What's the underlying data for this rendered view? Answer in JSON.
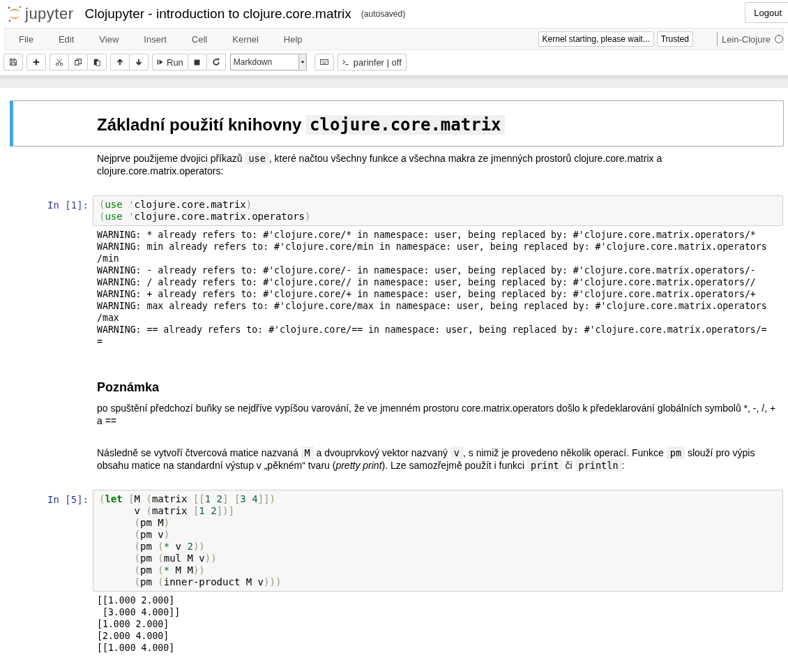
{
  "header": {
    "logo_text": "jupyter",
    "title": "Clojupyter - introduction to clojure.core.matrix",
    "save_status": "(autosaved)",
    "logout_button": "Logout"
  },
  "menu": [
    "File",
    "Edit",
    "View",
    "Insert",
    "Cell",
    "Kernel",
    "Help"
  ],
  "kernel_status": "Kernel starting, please wait...",
  "trusted": "Trusted",
  "kernel_name": "Lein-Clojure",
  "toolbar": {
    "run_button": "Run",
    "cell_type": "Markdown",
    "parinfer_button": "parinfer | off"
  },
  "cells": [
    {
      "kind": "markdown",
      "selected": true,
      "blocks": [
        {
          "kind": "h1",
          "segments": [
            {
              "text": "Základní použití knihovny ",
              "kind": "text"
            },
            {
              "text": "clojure.core.matrix",
              "kind": "code"
            }
          ]
        }
      ]
    },
    {
      "kind": "markdown",
      "selected": false,
      "blocks": [
        {
          "kind": "p",
          "segments": [
            {
              "text": "Nejprve použijeme dvojici příkazů ",
              "kind": "text"
            },
            {
              "text": "use",
              "kind": "code"
            },
            {
              "text": ", které načtou všechny funkce a všechna makra ze jmenných prostorů clojure.core.matrix a clojure.core.matrix.operators:",
              "kind": "text"
            }
          ]
        }
      ]
    },
    {
      "kind": "code",
      "selected": false,
      "prompt": "In [1]:",
      "lines": [
        [
          {
            "text": "(",
            "kind": "paren"
          },
          {
            "text": "use",
            "kind": "keyword"
          },
          {
            "text": " '",
            "kind": "paren"
          },
          {
            "text": "clojure.core.matrix",
            "kind": "text"
          },
          {
            "text": ")",
            "kind": "paren"
          }
        ],
        [
          {
            "text": "(",
            "kind": "paren"
          },
          {
            "text": "use",
            "kind": "keyword"
          },
          {
            "text": " '",
            "kind": "paren"
          },
          {
            "text": "clojure.core.matrix.operators",
            "kind": "text"
          },
          {
            "text": ")",
            "kind": "paren"
          }
        ]
      ],
      "output": [
        "WARNING: * already refers to: #'clojure.core/* in namespace: user, being replaced by: #'clojure.core.matrix.operators/*",
        "WARNING: min already refers to: #'clojure.core/min in namespace: user, being replaced by: #'clojure.core.matrix.operators",
        "/min",
        "WARNING: - already refers to: #'clojure.core/- in namespace: user, being replaced by: #'clojure.core.matrix.operators/-",
        "WARNING: / already refers to: #'clojure.core// in namespace: user, being replaced by: #'clojure.core.matrix.operators//",
        "WARNING: + already refers to: #'clojure.core/+ in namespace: user, being replaced by: #'clojure.core.matrix.operators/+",
        "WARNING: max already refers to: #'clojure.core/max in namespace: user, being replaced by: #'clojure.core.matrix.operators",
        "/max",
        "WARNING: == already refers to: #'clojure.core/== in namespace: user, being replaced by: #'clojure.core.matrix.operators/=",
        "="
      ]
    },
    {
      "kind": "markdown",
      "selected": false,
      "blocks": [
        {
          "kind": "h2",
          "segments": [
            {
              "text": "Poznámka",
              "kind": "text"
            }
          ]
        },
        {
          "kind": "p",
          "segments": [
            {
              "text": "po spuštění předchozí buňky se nejdříve vypíšou varování, že ve jmenném prostoru core.matrix.operators došlo k předeklarování globálních symbolů *, -, /, + a ==",
              "kind": "text"
            }
          ]
        },
        {
          "kind": "p",
          "segments": [
            {
              "text": "Následně se vytvoří čtvercová matice nazvaná ",
              "kind": "text"
            },
            {
              "text": "M",
              "kind": "code"
            },
            {
              "text": " a dvouprvkový vektor nazvaný ",
              "kind": "text"
            },
            {
              "text": "v",
              "kind": "code"
            },
            {
              "text": ", s nimiž je provedeno několik operací. Funkce ",
              "kind": "text"
            },
            {
              "text": "pm",
              "kind": "code"
            },
            {
              "text": " slouží pro výpis obsahu matice na standardní výstup v „pěkném“ tvaru (",
              "kind": "text"
            },
            {
              "text": "pretty print",
              "kind": "italic"
            },
            {
              "text": "). Lze samozřejmě použít i funkci ",
              "kind": "text"
            },
            {
              "text": "print",
              "kind": "code"
            },
            {
              "text": " či ",
              "kind": "text"
            },
            {
              "text": "println",
              "kind": "code"
            },
            {
              "text": ":",
              "kind": "text"
            }
          ]
        }
      ]
    },
    {
      "kind": "code",
      "selected": false,
      "prompt": "In [5]:",
      "lines": [
        [
          {
            "text": "(",
            "kind": "paren"
          },
          {
            "text": "let",
            "kind": "keyword-bold"
          },
          {
            "text": " [",
            "kind": "paren"
          },
          {
            "text": "M ",
            "kind": "text"
          },
          {
            "text": "(",
            "kind": "paren"
          },
          {
            "text": "matrix ",
            "kind": "text"
          },
          {
            "text": "[[",
            "kind": "paren"
          },
          {
            "text": "1 2",
            "kind": "number"
          },
          {
            "text": "] [",
            "kind": "paren"
          },
          {
            "text": "3 4",
            "kind": "number"
          },
          {
            "text": "]])",
            "kind": "paren"
          }
        ],
        [
          {
            "text": "      v ",
            "kind": "text"
          },
          {
            "text": "(",
            "kind": "paren"
          },
          {
            "text": "matrix ",
            "kind": "text"
          },
          {
            "text": "[",
            "kind": "paren"
          },
          {
            "text": "1 2",
            "kind": "number"
          },
          {
            "text": "])]",
            "kind": "paren"
          }
        ],
        [
          {
            "text": "      (",
            "kind": "paren"
          },
          {
            "text": "pm M",
            "kind": "text"
          },
          {
            "text": ")",
            "kind": "paren"
          }
        ],
        [
          {
            "text": "      (",
            "kind": "paren"
          },
          {
            "text": "pm v",
            "kind": "text"
          },
          {
            "text": ")",
            "kind": "paren"
          }
        ],
        [
          {
            "text": "      (",
            "kind": "paren"
          },
          {
            "text": "pm ",
            "kind": "text"
          },
          {
            "text": "(",
            "kind": "paren"
          },
          {
            "text": "*",
            "kind": "number"
          },
          {
            "text": " v ",
            "kind": "text"
          },
          {
            "text": "2",
            "kind": "number"
          },
          {
            "text": "))",
            "kind": "paren"
          }
        ],
        [
          {
            "text": "      (",
            "kind": "paren"
          },
          {
            "text": "pm ",
            "kind": "text"
          },
          {
            "text": "(",
            "kind": "paren"
          },
          {
            "text": "mul M v",
            "kind": "text"
          },
          {
            "text": "))",
            "kind": "paren"
          }
        ],
        [
          {
            "text": "      (",
            "kind": "paren"
          },
          {
            "text": "pm ",
            "kind": "text"
          },
          {
            "text": "(",
            "kind": "paren"
          },
          {
            "text": "*",
            "kind": "number"
          },
          {
            "text": " M M",
            "kind": "text"
          },
          {
            "text": "))",
            "kind": "paren"
          }
        ],
        [
          {
            "text": "      (",
            "kind": "paren"
          },
          {
            "text": "pm ",
            "kind": "text"
          },
          {
            "text": "(",
            "kind": "paren"
          },
          {
            "text": "inner-product M v",
            "kind": "text"
          },
          {
            "text": ")))",
            "kind": "paren"
          }
        ]
      ],
      "output": [
        "[[1.000 2.000]",
        " [3.000 4.000]]",
        "[1.000 2.000]",
        "[2.000 4.000]",
        "[[1.000 4.000]"
      ]
    }
  ]
}
